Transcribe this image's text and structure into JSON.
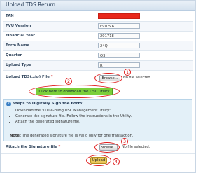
{
  "form": {
    "title": "Upload TDS Return"
  },
  "fields": [
    {
      "label": "TAN",
      "value": ""
    },
    {
      "label": "FVU Version",
      "value": "FVU 5.6"
    },
    {
      "label": "Financial Year",
      "value": "201718"
    },
    {
      "label": "Form Name",
      "value": "24Q"
    },
    {
      "label": "Quarter",
      "value": "Q3"
    },
    {
      "label": "Upload Type",
      "value": "R"
    }
  ],
  "upload_tds": {
    "label": "Upload TDS(.zip) File",
    "required_mark": "*",
    "browse_label": "Browse...",
    "status": "No file selected."
  },
  "dsc": {
    "button_label": "Click here to download the DSC Utility"
  },
  "steps": {
    "heading": "Steps to Digitally Sign the Form:",
    "items": [
      "Download the \"ITD e-Filing DSC Management Utility\".",
      "Generate the signature file. Follow the instructions in the Utility.",
      "Attach the generated signature file."
    ],
    "note_label": "Note:",
    "note_text": "The generated signature file is valid only for one transaction."
  },
  "signature": {
    "label": "Attach the Signature file",
    "required_mark": "*",
    "browse_label": "Browse...",
    "status": "No file selected."
  },
  "upload": {
    "button_label": "Upload"
  },
  "annotations": {
    "n1": "1",
    "n2": "2",
    "n3": "3",
    "n4": "4"
  },
  "colors": {
    "annotation_red": "#e01b1b",
    "dsc_green": "#7ccf3a",
    "upload_gold": "#e9c75a",
    "title_bar": "#dbe7f3"
  }
}
